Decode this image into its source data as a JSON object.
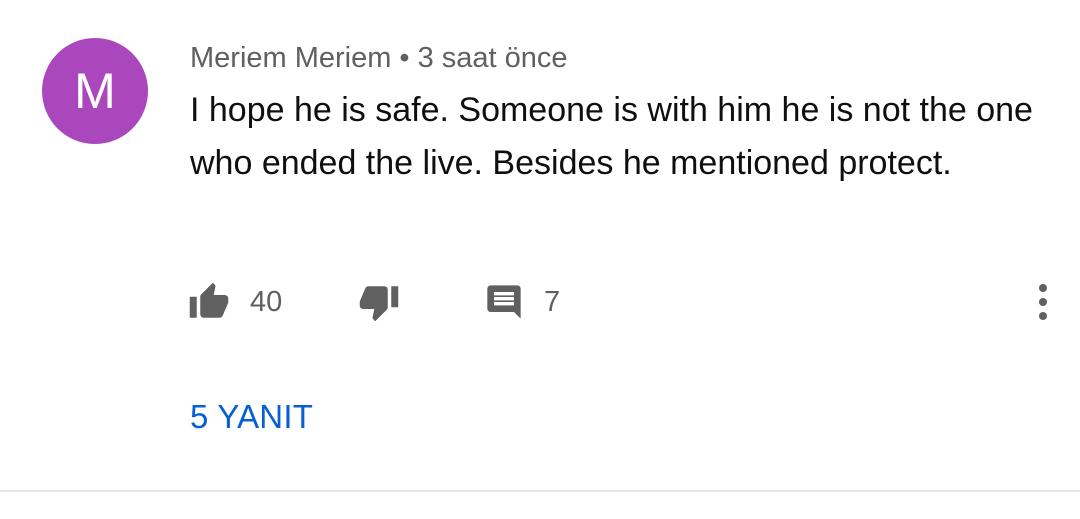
{
  "comment": {
    "avatar_letter": "M",
    "avatar_color": "#ab47bc",
    "author": "Meriem Meriem",
    "separator": "•",
    "timestamp": "3 saat önce",
    "text": "I hope he is safe.  Someone is with him he is not the one who ended the live. Besides he mentioned protect.",
    "like_count": "40",
    "reply_count": "7",
    "replies_link": "5 YANIT",
    "icons": [
      "thumb-up-icon",
      "thumb-down-icon",
      "comment-icon",
      "more-vert-icon"
    ],
    "link_color": "#065fd4"
  }
}
